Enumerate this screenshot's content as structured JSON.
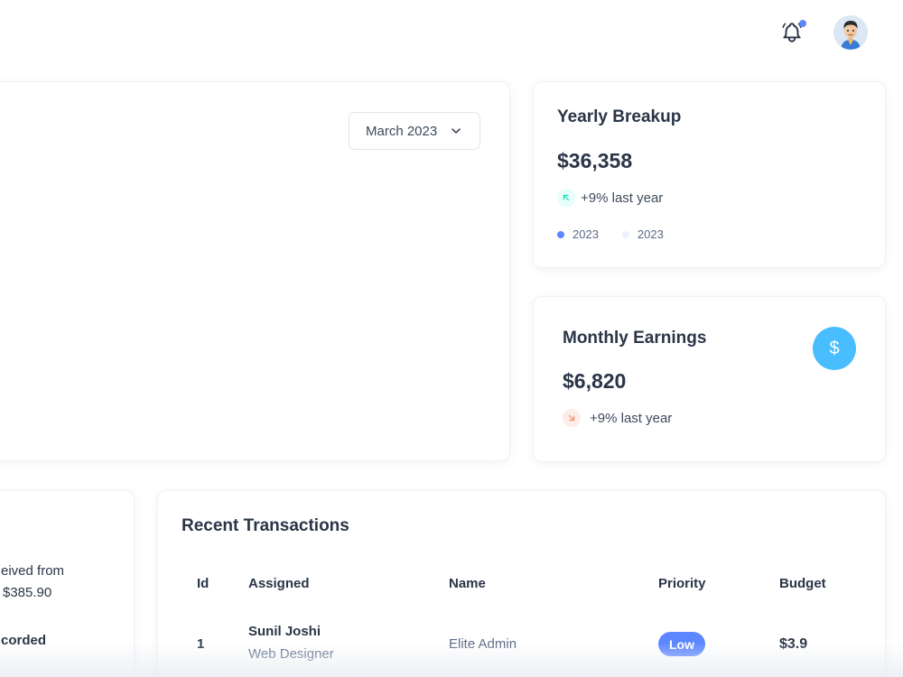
{
  "header": {
    "notification_icon": "bell-icon",
    "has_notification": true,
    "avatar": "user-avatar"
  },
  "overview": {
    "month_select": {
      "value": "March 2023",
      "icon": "chevron-down-icon"
    }
  },
  "yearly_breakup": {
    "title": "Yearly Breakup",
    "value": "$36,358",
    "trend_icon": "arrow-up-left-icon",
    "trend_text": "+9% last year",
    "legend": [
      {
        "label": "2023",
        "color": "#5d87ff"
      },
      {
        "label": "2023",
        "color": "#ecf2ff"
      }
    ]
  },
  "monthly_earnings": {
    "title": "Monthly Earnings",
    "value": "$6,820",
    "trend_icon": "arrow-down-right-icon",
    "trend_text": "+9% last year",
    "action_icon": "dollar-icon",
    "action_symbol": "$"
  },
  "timeline": {
    "line1": "eived from",
    "line2": "$385.90",
    "line3": "corded"
  },
  "recent_transactions": {
    "title": "Recent Transactions",
    "columns": [
      "Id",
      "Assigned",
      "Name",
      "Priority",
      "Budget"
    ],
    "rows": [
      {
        "id": "1",
        "assigned_name": "Sunil Joshi",
        "assigned_role": "Web Designer",
        "name": "Elite Admin",
        "priority": "Low",
        "budget": "$3.9"
      }
    ]
  },
  "colors": {
    "primary": "#5d87ff",
    "secondary": "#49beff",
    "success": "#13deb9",
    "error": "#fa896b",
    "text_dark": "#2a3547"
  }
}
